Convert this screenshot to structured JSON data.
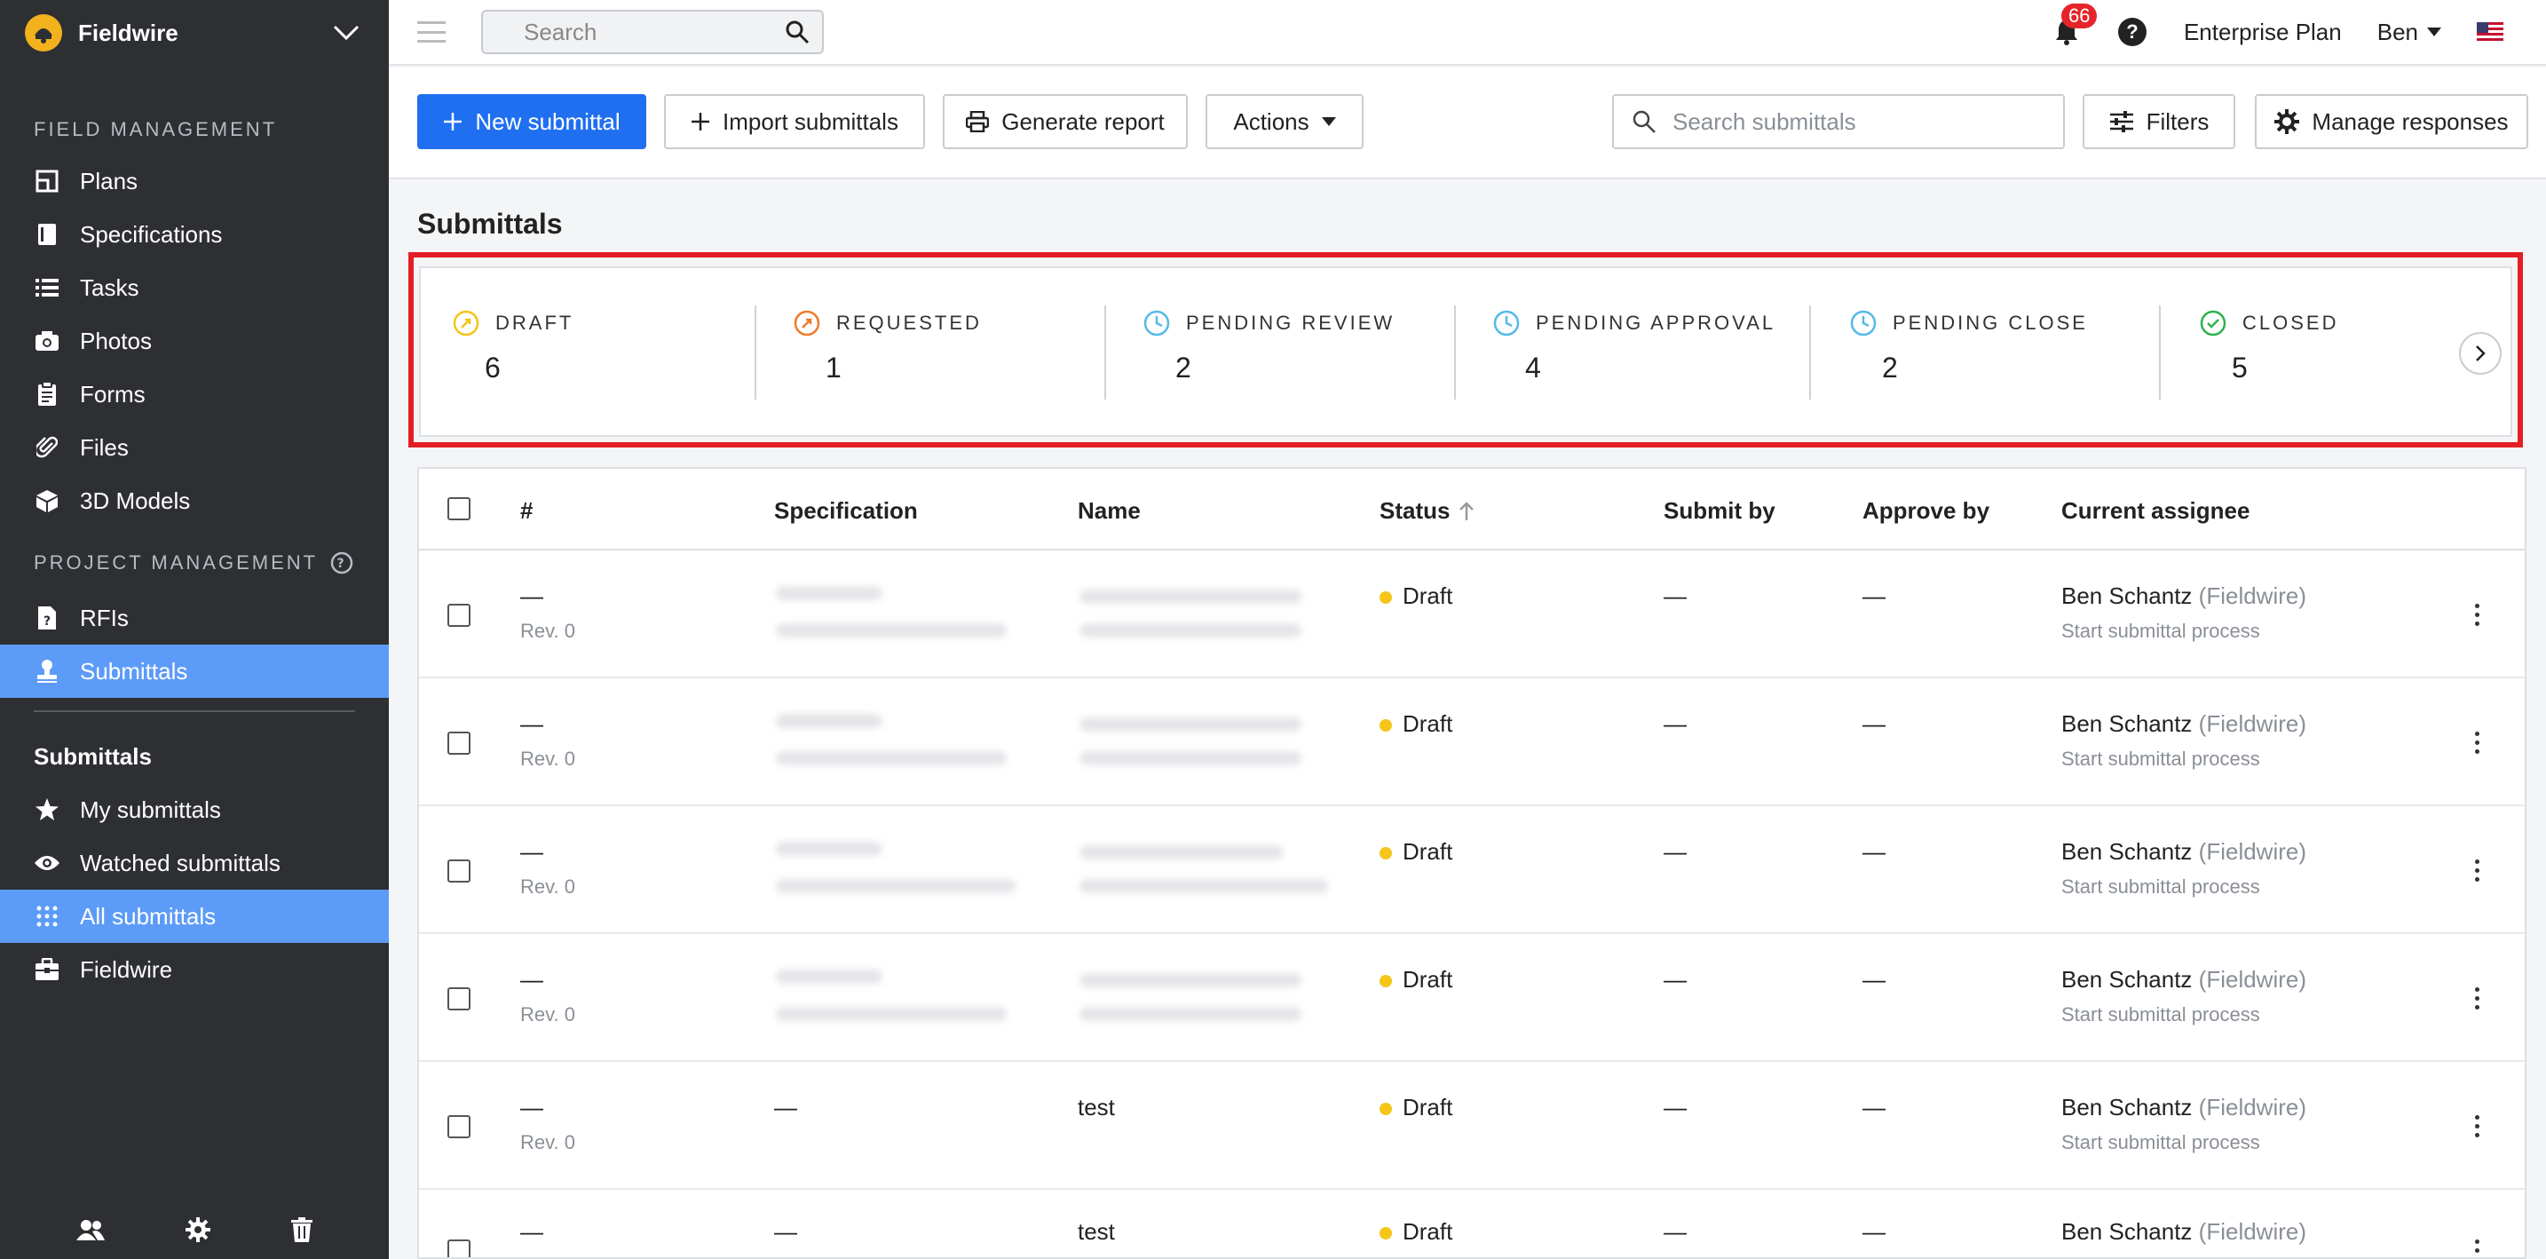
{
  "sidebar": {
    "org_name": "Fieldwire",
    "field_section": "FIELD MANAGEMENT",
    "field_items": [
      {
        "label": "Plans",
        "icon": "plans-icon"
      },
      {
        "label": "Specifications",
        "icon": "specifications-icon"
      },
      {
        "label": "Tasks",
        "icon": "tasks-icon"
      },
      {
        "label": "Photos",
        "icon": "camera-icon"
      },
      {
        "label": "Forms",
        "icon": "forms-icon"
      },
      {
        "label": "Files",
        "icon": "paperclip-icon"
      },
      {
        "label": "3D Models",
        "icon": "cube-icon"
      }
    ],
    "project_section": "PROJECT MANAGEMENT",
    "project_items": [
      {
        "label": "RFIs",
        "icon": "rfi-icon"
      },
      {
        "label": "Submittals",
        "icon": "stamp-icon"
      }
    ],
    "sub_heading": "Submittals",
    "sub_items": [
      {
        "label": "My submittals",
        "icon": "star-icon"
      },
      {
        "label": "Watched submittals",
        "icon": "eye-icon"
      },
      {
        "label": "All submittals",
        "icon": "grid-icon"
      },
      {
        "label": "Fieldwire",
        "icon": "briefcase-icon"
      }
    ]
  },
  "topbar": {
    "search_placeholder": "Search",
    "notification_count": "66",
    "help_label": "?",
    "plan_label": "Enterprise Plan",
    "user_name": "Ben"
  },
  "toolbar": {
    "new_label": "New submittal",
    "import_label": "Import submittals",
    "report_label": "Generate report",
    "actions_label": "Actions",
    "search_placeholder": "Search submittals",
    "filters_label": "Filters",
    "manage_label": "Manage responses"
  },
  "page": {
    "title": "Submittals"
  },
  "summary": [
    {
      "label": "DRAFT",
      "value": "6",
      "color": "#f5c518"
    },
    {
      "label": "REQUESTED",
      "value": "1",
      "color": "#f07b2a"
    },
    {
      "label": "PENDING REVIEW",
      "value": "2",
      "color": "#55b9e8"
    },
    {
      "label": "PENDING APPROVAL",
      "value": "4",
      "color": "#55b9e8"
    },
    {
      "label": "PENDING CLOSE",
      "value": "2",
      "color": "#55b9e8"
    },
    {
      "label": "CLOSED",
      "value": "5",
      "color": "#2fb34a"
    }
  ],
  "table": {
    "columns": [
      "#",
      "Specification",
      "Name",
      "Status",
      "Submit by",
      "Approve by",
      "Current assignee"
    ],
    "rows": [
      {
        "num": "—",
        "rev": "Rev. 0",
        "spec": "",
        "name": "",
        "status": "Draft",
        "submit_by": "—",
        "approve_by": "—",
        "assignee": "Ben Schantz",
        "org": "(Fieldwire)",
        "action": "Start submittal process"
      },
      {
        "num": "—",
        "rev": "Rev. 0",
        "spec": "",
        "name": "",
        "status": "Draft",
        "submit_by": "—",
        "approve_by": "—",
        "assignee": "Ben Schantz",
        "org": "(Fieldwire)",
        "action": "Start submittal process"
      },
      {
        "num": "—",
        "rev": "Rev. 0",
        "spec": "",
        "name": "",
        "status": "Draft",
        "submit_by": "—",
        "approve_by": "—",
        "assignee": "Ben Schantz",
        "org": "(Fieldwire)",
        "action": "Start submittal process"
      },
      {
        "num": "—",
        "rev": "Rev. 0",
        "spec": "",
        "name": "",
        "status": "Draft",
        "submit_by": "—",
        "approve_by": "—",
        "assignee": "Ben Schantz",
        "org": "(Fieldwire)",
        "action": "Start submittal process"
      },
      {
        "num": "—",
        "rev": "Rev. 0",
        "spec": "—",
        "name": "test",
        "status": "Draft",
        "submit_by": "—",
        "approve_by": "—",
        "assignee": "Ben Schantz",
        "org": "(Fieldwire)",
        "action": "Start submittal process"
      },
      {
        "num": "—",
        "rev": "",
        "spec": "—",
        "name": "test",
        "status": "Draft",
        "submit_by": "—",
        "approve_by": "—",
        "assignee": "Ben Schantz",
        "org": "(Fieldwire)",
        "action": ""
      }
    ]
  }
}
